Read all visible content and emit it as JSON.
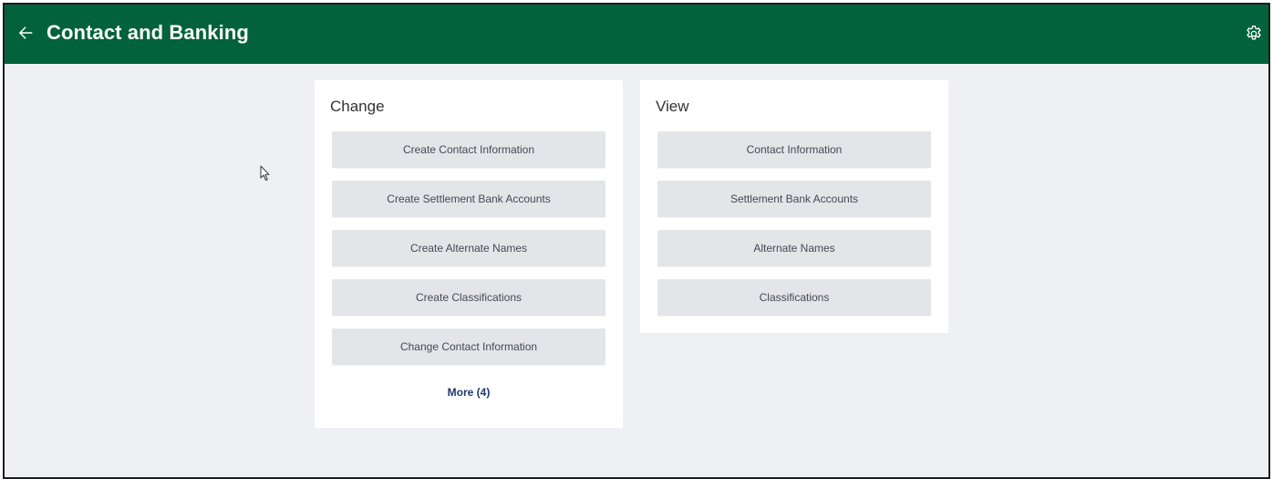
{
  "header": {
    "title": "Contact and Banking",
    "back_icon": "arrow-left-icon",
    "settings_icon": "gear-icon",
    "background_color": "#02623b"
  },
  "change_card": {
    "title": "Change",
    "buttons": [
      {
        "label": "Create Contact Information"
      },
      {
        "label": "Create Settlement Bank Accounts"
      },
      {
        "label": "Create Alternate Names"
      },
      {
        "label": "Create Classifications"
      },
      {
        "label": "Change Contact Information"
      }
    ],
    "more_label": "More (4)"
  },
  "view_card": {
    "title": "View",
    "buttons": [
      {
        "label": "Contact Information"
      },
      {
        "label": "Settlement Bank Accounts"
      },
      {
        "label": "Alternate Names"
      },
      {
        "label": "Classifications"
      }
    ]
  }
}
